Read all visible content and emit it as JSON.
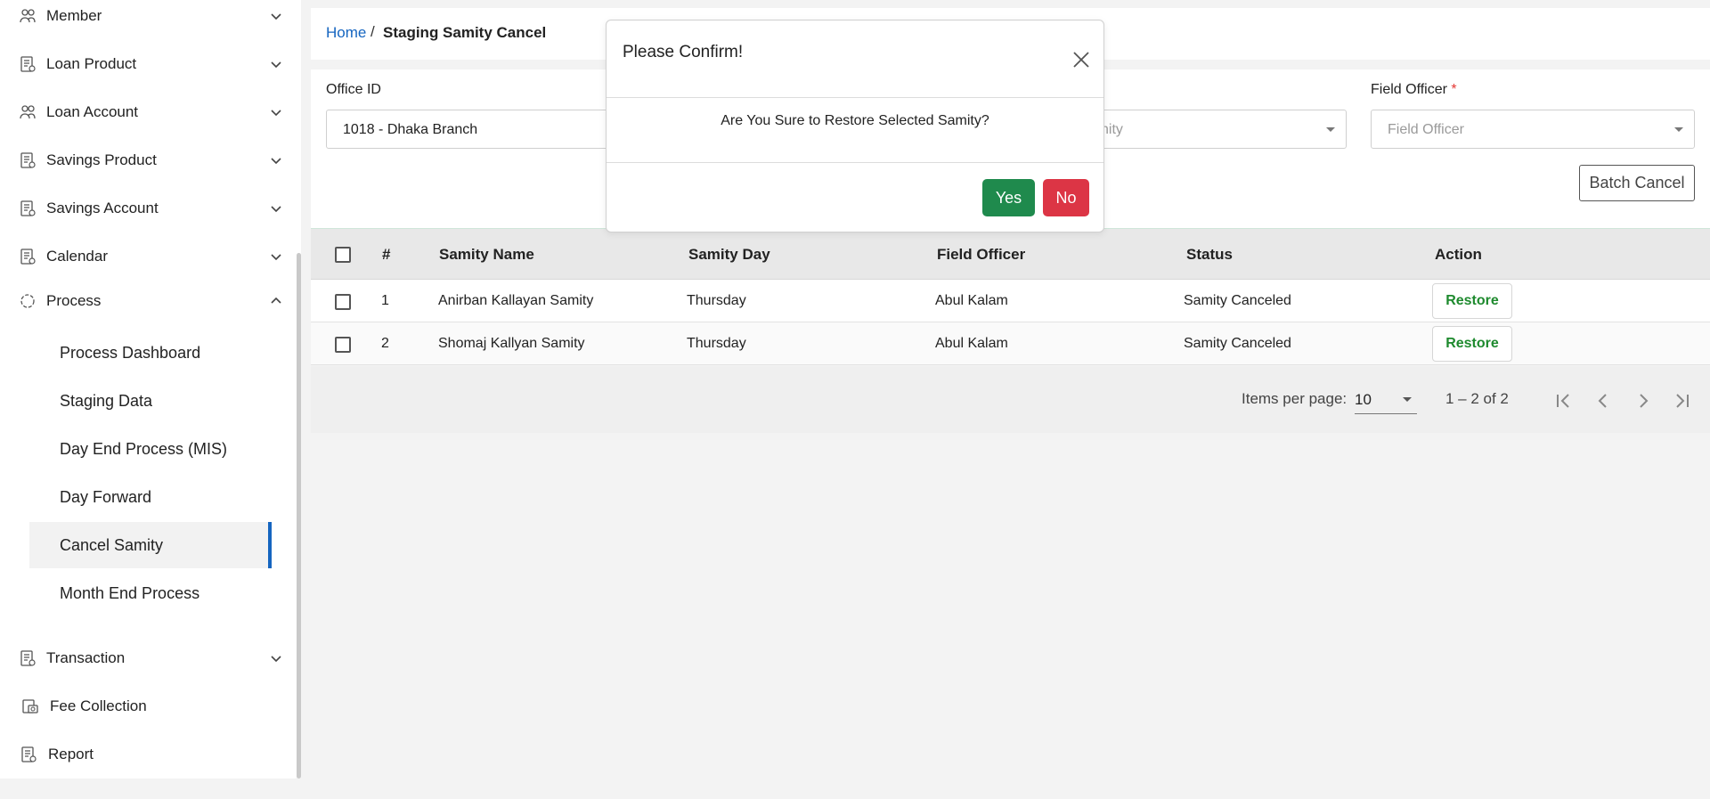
{
  "sidebar": {
    "items": [
      {
        "label": "Member",
        "icon": "users-icon"
      },
      {
        "label": "Loan Product",
        "icon": "document-icon"
      },
      {
        "label": "Loan Account",
        "icon": "users-icon"
      },
      {
        "label": "Savings Product",
        "icon": "document-icon"
      },
      {
        "label": "Savings Account",
        "icon": "document-icon"
      },
      {
        "label": "Calendar",
        "icon": "document-icon"
      },
      {
        "label": "Process",
        "icon": "process-icon"
      },
      {
        "label": "Transaction",
        "icon": "document-icon"
      },
      {
        "label": "Fee Collection",
        "icon": "fee-icon"
      },
      {
        "label": "Report",
        "icon": "document-icon"
      }
    ],
    "process_sub": [
      {
        "label": "Process Dashboard"
      },
      {
        "label": "Staging Data"
      },
      {
        "label": "Day End Process (MIS)"
      },
      {
        "label": "Day Forward"
      },
      {
        "label": "Cancel Samity"
      },
      {
        "label": "Month End Process"
      }
    ],
    "active_color": "#1565c0"
  },
  "breadcrumb": {
    "home": "Home",
    "separator": "/",
    "current": "Staging Samity Cancel"
  },
  "filters": {
    "office_label": "Office ID",
    "office_value": "1018 - Dhaka Branch",
    "samity_placeholder": "nity",
    "field_officer_label": "Field Officer",
    "field_officer_required": "*",
    "field_officer_placeholder": "Field Officer",
    "batch_cancel_label": "Batch Cancel"
  },
  "table": {
    "headers": {
      "num": "#",
      "samity_name": "Samity Name",
      "samity_day": "Samity Day",
      "field_officer": "Field Officer",
      "status": "Status",
      "action": "Action"
    },
    "rows": [
      {
        "num": "1",
        "samity_name": "Anirban Kallayan Samity",
        "samity_day": "Thursday",
        "field_officer": "Abul Kalam",
        "status": "Samity Canceled",
        "action": "Restore"
      },
      {
        "num": "2",
        "samity_name": "Shomaj Kallyan Samity",
        "samity_day": "Thursday",
        "field_officer": "Abul Kalam",
        "status": "Samity Canceled",
        "action": "Restore"
      }
    ]
  },
  "paginator": {
    "items_per_page_label": "Items per page:",
    "items_per_page_value": "10",
    "range": "1 – 2 of 2"
  },
  "modal": {
    "title": "Please Confirm!",
    "message": "Are You Sure to Restore Selected Samity?",
    "yes": "Yes",
    "no": "No",
    "yes_color": "#1f8a4d",
    "no_color": "#dc3545"
  }
}
